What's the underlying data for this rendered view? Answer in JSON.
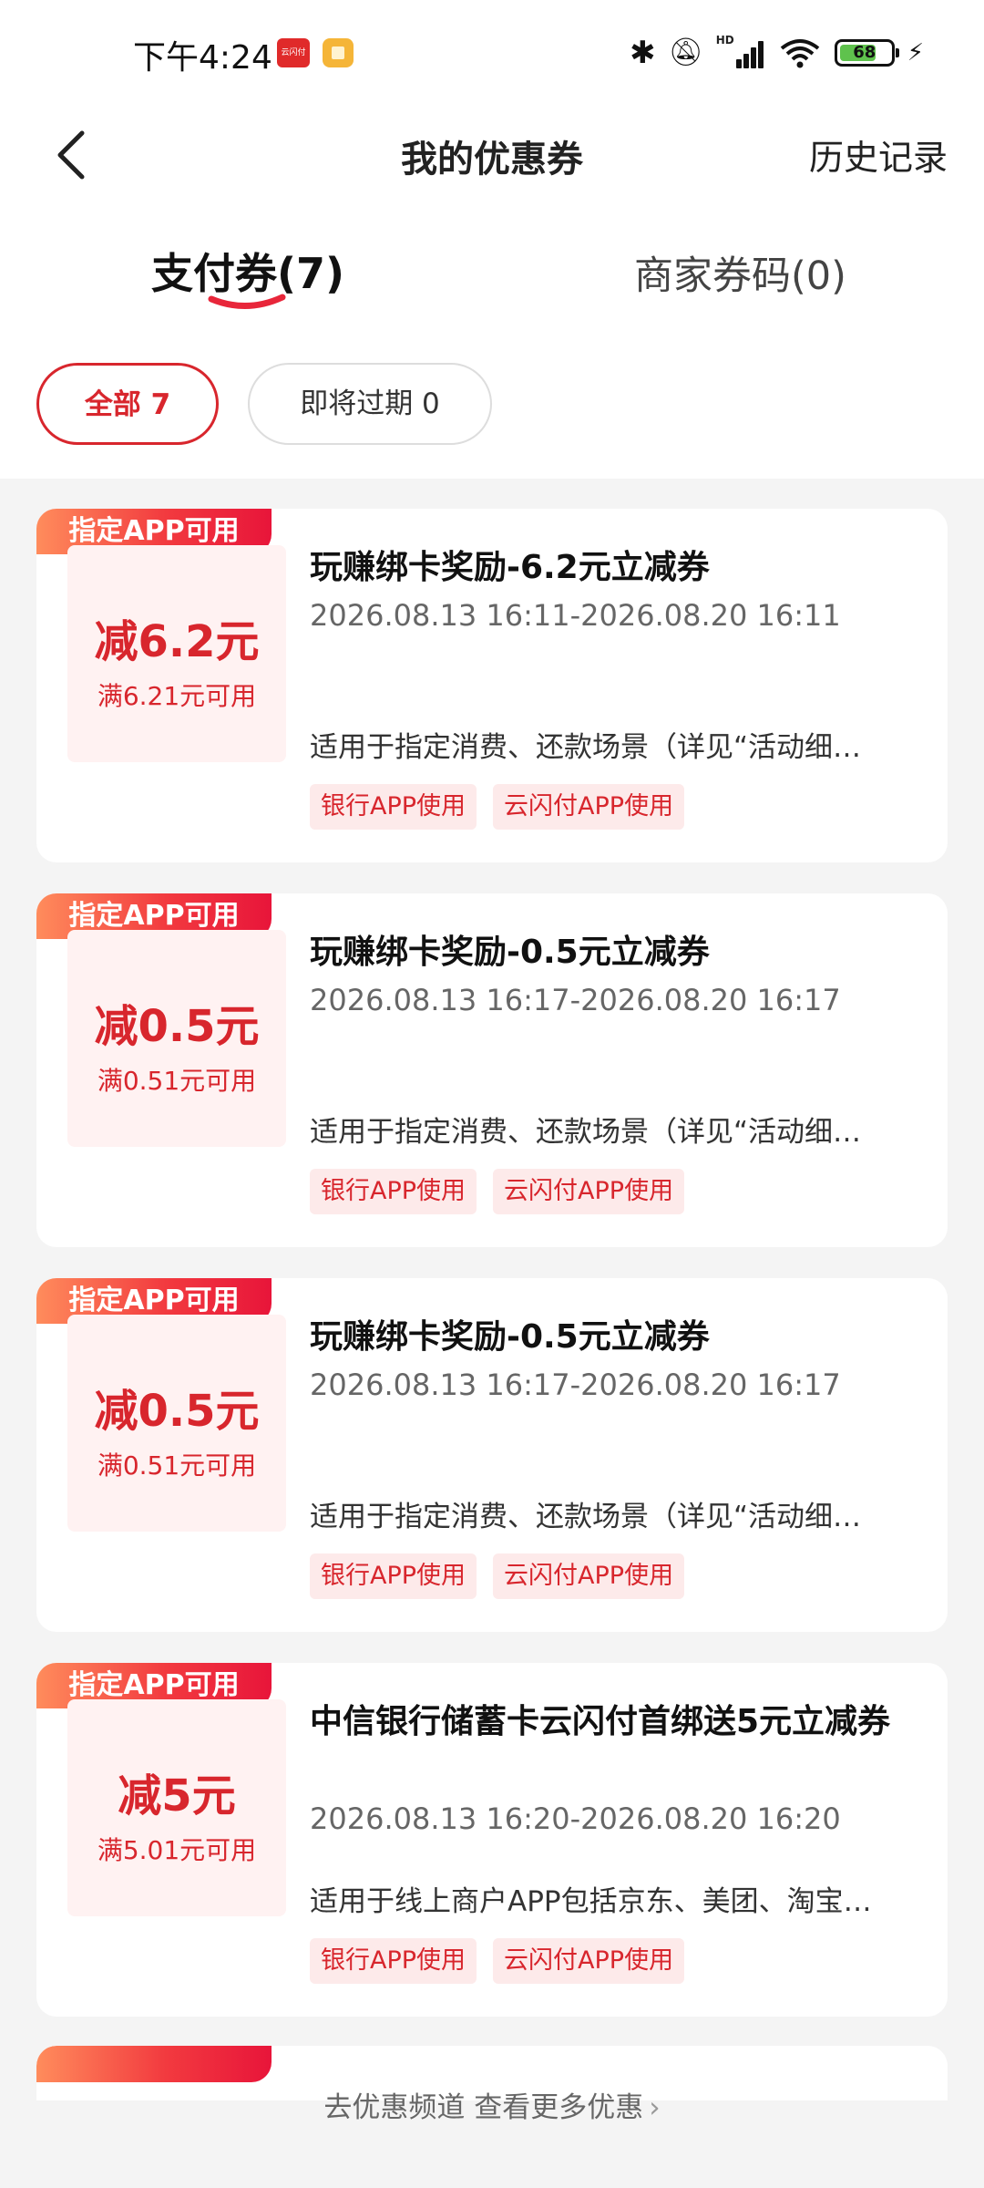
{
  "status_bar": {
    "time": "下午4:24",
    "app1_label": "云闪付",
    "battery": "68"
  },
  "nav": {
    "title": "我的优惠券",
    "history": "历史记录"
  },
  "tabs": [
    {
      "label": "支付券(7)"
    },
    {
      "label": "商家券码(0)"
    }
  ],
  "filters": [
    {
      "label": "全部 7"
    },
    {
      "label": "即将过期 0"
    }
  ],
  "coupons": [
    {
      "tag": "指定APP可用",
      "amount": "减6.2元",
      "condition": "满6.21元可用",
      "title": "玩赚绑卡奖励-6.2元立减券",
      "time": "2026.08.13 16:11-2026.08.20 16:11",
      "desc": "适用于指定消费、还款场景（详见“活动细…",
      "badges": [
        "银行APP使用",
        "云闪付APP使用"
      ]
    },
    {
      "tag": "指定APP可用",
      "amount": "减0.5元",
      "condition": "满0.51元可用",
      "title": "玩赚绑卡奖励-0.5元立减券",
      "time": "2026.08.13 16:17-2026.08.20 16:17",
      "desc": "适用于指定消费、还款场景（详见“活动细…",
      "badges": [
        "银行APP使用",
        "云闪付APP使用"
      ]
    },
    {
      "tag": "指定APP可用",
      "amount": "减0.5元",
      "condition": "满0.51元可用",
      "title": "玩赚绑卡奖励-0.5元立减券",
      "time": "2026.08.13 16:17-2026.08.20 16:17",
      "desc": "适用于指定消费、还款场景（详见“活动细…",
      "badges": [
        "银行APP使用",
        "云闪付APP使用"
      ]
    },
    {
      "tag": "指定APP可用",
      "amount": "减5元",
      "condition": "满5.01元可用",
      "title": "中信银行储蓄卡云闪付首绑送5元立减券",
      "time": "2026.08.13 16:20-2026.08.20 16:20",
      "desc": "适用于线上商户APP包括京东、美团、淘宝…",
      "badges": [
        "银行APP使用",
        "云闪付APP使用"
      ]
    }
  ],
  "footer": {
    "link": "去优惠频道 查看更多优惠"
  },
  "colors": {
    "accent": "#d8262d",
    "tag_gradient_start": "#ff8c5c",
    "tag_gradient_end": "#e8153a",
    "coupon_bg": "#fff2f2"
  },
  "icons": {
    "back": "chevron-left-icon",
    "bluetooth": "bluetooth-icon",
    "mute": "bell-off-icon",
    "signal": "signal-icon",
    "wifi": "wifi-icon",
    "battery": "battery-icon",
    "charging": "charging-bolt-icon",
    "more": "chevron-right-icon"
  }
}
